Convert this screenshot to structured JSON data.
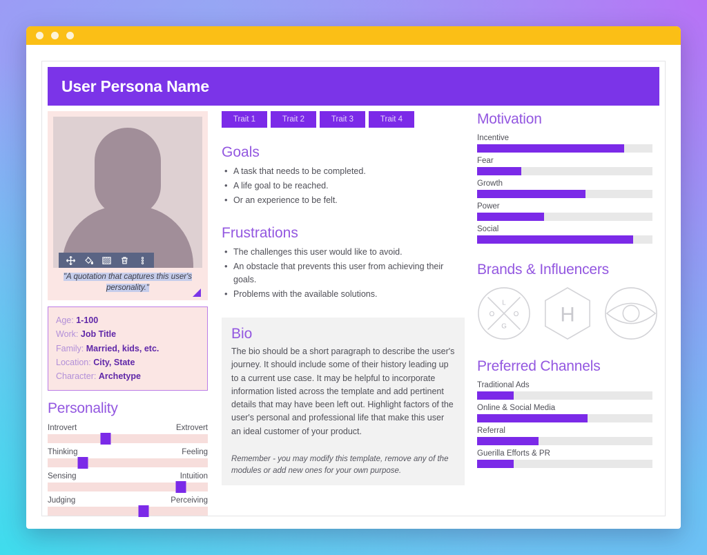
{
  "window": {
    "dots": 3,
    "titlebar_color": "#fbbf16"
  },
  "header": {
    "title": "User Persona Name",
    "background": "#7b34e8"
  },
  "photo": {
    "toolbar_icons": [
      "move-icon",
      "paint-bucket-icon",
      "pattern-fill-icon",
      "trash-icon",
      "more-options-icon"
    ],
    "quote": "\"A quotation that captures this user's personality.\"",
    "avatar_alt": "placeholder-person-silhouette"
  },
  "info": {
    "rows": [
      {
        "label": "Age:",
        "value": "1-100"
      },
      {
        "label": "Work:",
        "value": "Job Title"
      },
      {
        "label": "Family:",
        "value": "Married, kids, etc."
      },
      {
        "label": "Location:",
        "value": "City, State"
      },
      {
        "label": "Character:",
        "value": "Archetype"
      }
    ]
  },
  "personality": {
    "title": "Personality",
    "sliders": [
      {
        "left": "Introvert",
        "right": "Extrovert",
        "value": 36
      },
      {
        "left": "Thinking",
        "right": "Feeling",
        "value": 22
      },
      {
        "left": "Sensing",
        "right": "Intuition",
        "value": 83
      },
      {
        "left": "Judging",
        "right": "Perceiving",
        "value": 60
      }
    ]
  },
  "traits": [
    {
      "label": "Trait 1"
    },
    {
      "label": "Trait 2"
    },
    {
      "label": "Trait 3"
    },
    {
      "label": "Trait 4"
    }
  ],
  "goals": {
    "title": "Goals",
    "items": [
      "A task that needs to be completed.",
      "A life goal to be reached.",
      "Or an experience to be felt."
    ]
  },
  "frustrations": {
    "title": "Frustrations",
    "items": [
      "The challenges this user would like to avoid.",
      "An obstacle that prevents this user from achieving their goals.",
      "Problems with the available solutions."
    ]
  },
  "bio": {
    "title": "Bio",
    "text": "The bio should be a short paragraph to describe the user's journey. It should include some of their history leading up to a current use case. It may be helpful to incorporate information listed across the template and add pertinent details that may have been left out. Highlight factors of the user's personal and professional life that make this user an ideal customer of your product.",
    "note": "Remember - you may modify this template, remove any of the modules or add new ones for your own purpose."
  },
  "motivation": {
    "title": "Motivation",
    "bars": [
      {
        "label": "Incentive",
        "value": 84
      },
      {
        "label": "Fear",
        "value": 25
      },
      {
        "label": "Growth",
        "value": 62
      },
      {
        "label": "Power",
        "value": 38
      },
      {
        "label": "Social",
        "value": 89
      }
    ]
  },
  "brands": {
    "title": "Brands & Influencers",
    "logos": [
      {
        "name": "circle-x-logo-placeholder",
        "letters": [
          "L",
          "O",
          "G",
          "O"
        ]
      },
      {
        "name": "hexagon-h-logo-placeholder",
        "letter": "H"
      },
      {
        "name": "eye-circle-logo-placeholder"
      }
    ]
  },
  "channels": {
    "title": "Preferred Channels",
    "bars": [
      {
        "label": "Traditional Ads",
        "value": 21
      },
      {
        "label": "Online & Social Media",
        "value": 63
      },
      {
        "label": "Referral",
        "value": 35
      },
      {
        "label": "Guerilla Efforts & PR",
        "value": 21
      }
    ]
  },
  "colors": {
    "accent_purple": "#7b2ae8",
    "header_purple": "#7b34e8",
    "title_purple": "#9357e0",
    "pink_panel": "#fbe6e4",
    "titlebar_yellow": "#fbbf16",
    "bar_track": "#e8e8e8",
    "toolbar_slate": "#5a6484"
  }
}
